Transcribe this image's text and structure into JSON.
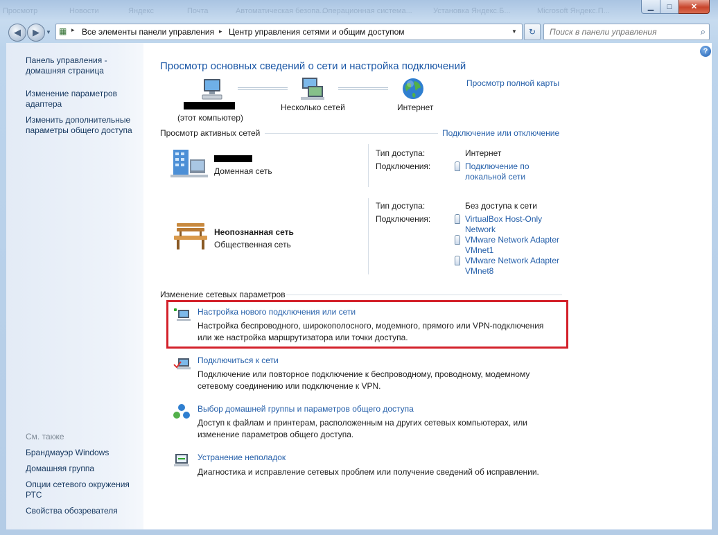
{
  "window": {
    "ghost_tabs": [
      "Просмотр",
      "Новости",
      "Яндекс",
      "Почта",
      "Автоматическая безопа...",
      "Операционная система...",
      "Установка Яндекс.Б...",
      "Microsoft Яндекс.П..."
    ]
  },
  "address_bar": {
    "crumb1": "Все элементы панели управления",
    "crumb2": "Центр управления сетями и общим доступом",
    "search_placeholder": "Поиск в панели управления"
  },
  "sidebar": {
    "items": [
      "Панель управления -\nдомашняя страница",
      "Изменение параметров\nадаптера",
      "Изменить дополнительные\nпараметры общего доступа"
    ],
    "see_also_label": "См. также",
    "see_also": [
      "Брандмауэр Windows",
      "Домашняя группа",
      "Опции сетевого окружения\nРТС",
      "Свойства обозревателя"
    ]
  },
  "main": {
    "title": "Просмотр основных сведений о сети и настройка подключений",
    "full_map_link": "Просмотр полной карты",
    "map": {
      "computer_sub": "(этот компьютер)",
      "middle": "Несколько сетей",
      "internet": "Интернет"
    },
    "active_section": "Просмотр активных сетей",
    "connect_link": "Подключение или отключение",
    "networks": [
      {
        "name": "",
        "type": "Доменная сеть",
        "access_label": "Тип доступа:",
        "access_value": "Интернет",
        "conn_label": "Подключения:",
        "connections": [
          "Подключение по\nлокальной сети"
        ]
      },
      {
        "name": "Неопознанная сеть",
        "type": "Общественная сеть",
        "access_label": "Тип доступа:",
        "access_value": "Без доступа к сети",
        "conn_label": "Подключения:",
        "connections": [
          "VirtualBox Host-Only\nNetwork",
          "VMware Network Adapter\nVMnet1",
          "VMware Network Adapter\nVMnet8"
        ]
      }
    ],
    "change_section": "Изменение сетевых параметров",
    "tasks": [
      {
        "title": "Настройка нового подключения или сети",
        "desc": "Настройка беспроводного, широкополосного, модемного, прямого или VPN-подключения\nили же настройка маршрутизатора или точки доступа."
      },
      {
        "title": "Подключиться к сети",
        "desc": "Подключение или повторное подключение к беспроводному, проводному, модемному\nсетевому соединению или подключение к VPN."
      },
      {
        "title": "Выбор домашней группы и параметров общего доступа",
        "desc": "Доступ к файлам и принтерам, расположенным на других сетевых компьютерах, или\nизменение параметров общего доступа."
      },
      {
        "title": "Устранение неполадок",
        "desc": "Диагностика и исправление сетевых проблем или получение сведений об исправлении."
      }
    ]
  },
  "colors": {
    "link": "#2660aa",
    "highlight": "#d3202a",
    "title": "#1b57a6"
  }
}
